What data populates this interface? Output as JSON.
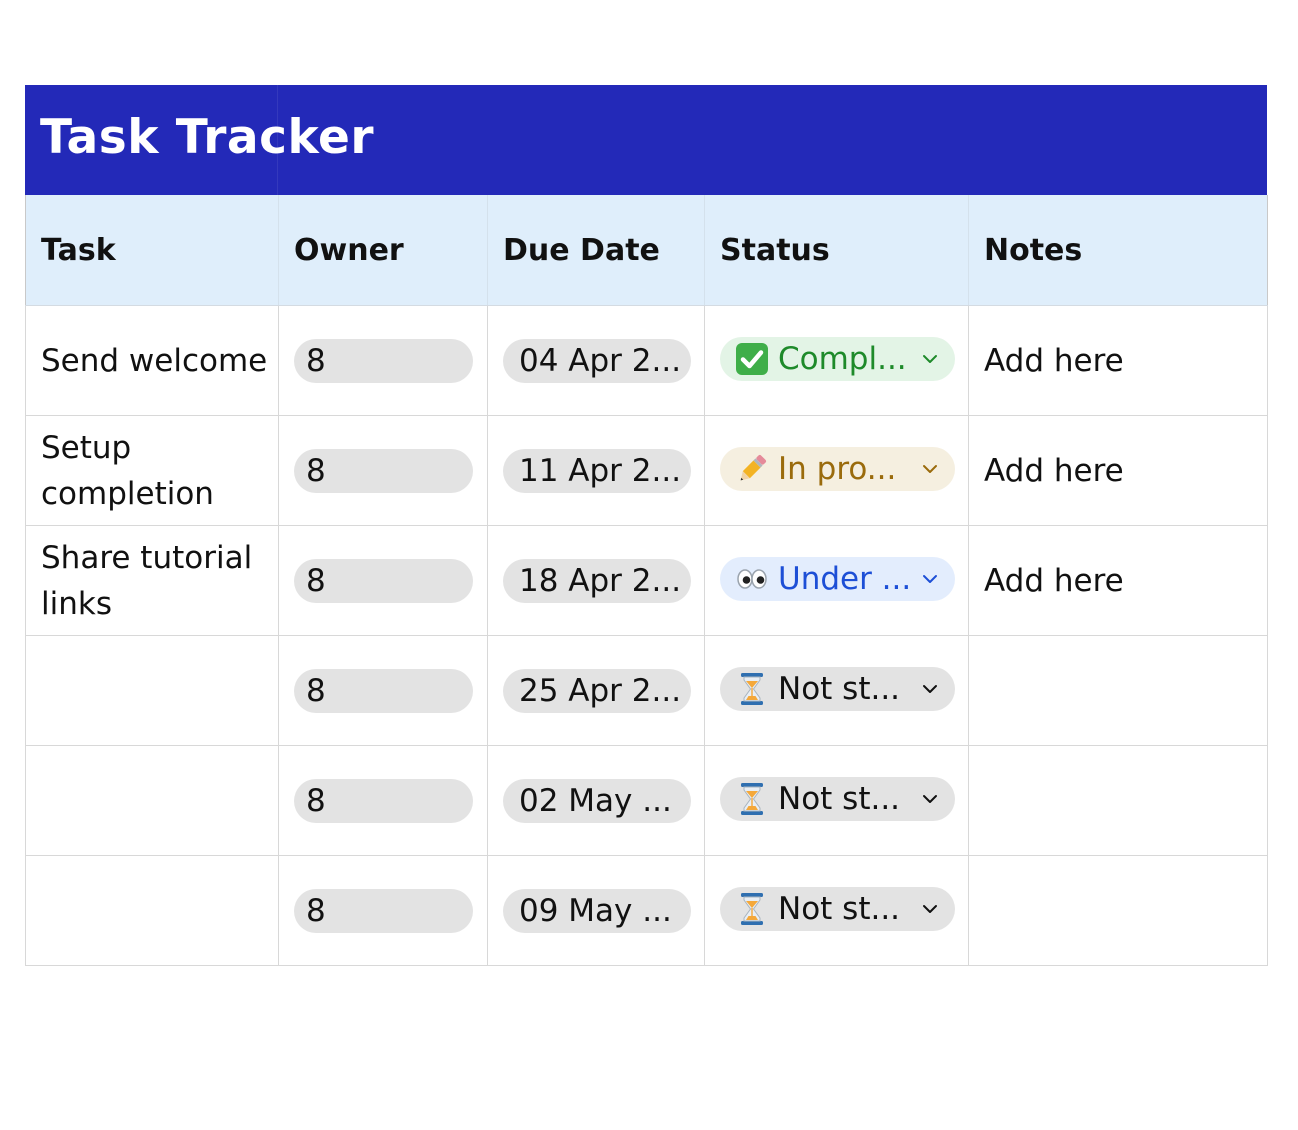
{
  "title": "Task Tracker",
  "columns": [
    "Task",
    "Owner",
    "Due Date",
    "Status",
    "Notes"
  ],
  "rows": [
    {
      "task": "Send welcome",
      "owner": "8",
      "due": "04 Apr 2...",
      "status": "Compl...",
      "status_icon": "check-mark-icon",
      "notes": "Add here"
    },
    {
      "task": "Setup completion",
      "owner": "8",
      "due": "11 Apr 2...",
      "status": "In pro...",
      "status_icon": "pencil-icon",
      "notes": "Add here"
    },
    {
      "task": "Share tutorial links",
      "owner": "8",
      "due": "18 Apr 2...",
      "status": "Under ...",
      "status_icon": "eyes-icon",
      "notes": "Add here"
    },
    {
      "task": "",
      "owner": "8",
      "due": "25 Apr 2...",
      "status": "Not st...",
      "status_icon": "hourglass-icon",
      "notes": ""
    },
    {
      "task": "",
      "owner": "8",
      "due": "02 May ...",
      "status": "Not st...",
      "status_icon": "hourglass-icon",
      "notes": ""
    },
    {
      "task": "",
      "owner": "8",
      "due": "09 May ...",
      "status": "Not st...",
      "status_icon": "hourglass-icon",
      "notes": ""
    }
  ],
  "colors": {
    "title_bar": "#2329b8",
    "header_bg": "#dfeefb",
    "complete": "#1e8a2a",
    "in_progress": "#9a6b0c",
    "under_review": "#1d4fd6"
  }
}
